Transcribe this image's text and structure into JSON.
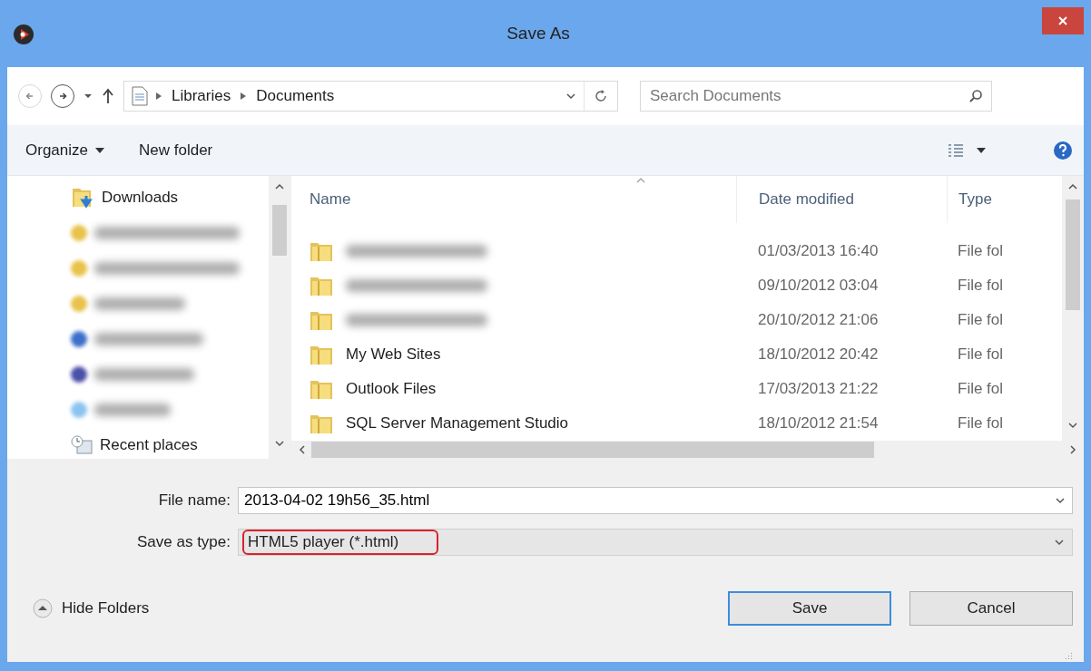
{
  "window": {
    "title": "Save As"
  },
  "nav": {
    "back": {
      "disabled": true
    },
    "forward": {
      "disabled": false
    }
  },
  "address": {
    "crumbs": [
      "Libraries",
      "Documents"
    ]
  },
  "search": {
    "placeholder": "Search Documents"
  },
  "toolbar": {
    "buttons": [
      {
        "label": "Organize",
        "dropdown": true
      },
      {
        "label": "New folder",
        "dropdown": false
      }
    ]
  },
  "sidebar": {
    "items": [
      {
        "kind": "downloads",
        "label": "Downloads"
      },
      {
        "kind": "blurred",
        "color": "#e8c24a"
      },
      {
        "kind": "blurred",
        "color": "#e8c24a"
      },
      {
        "kind": "blurred",
        "color": "#e8c24a"
      },
      {
        "kind": "blurred",
        "color": "#3b6fc9"
      },
      {
        "kind": "blurred",
        "color": "#4a4fa8"
      },
      {
        "kind": "blurred",
        "color": "#8cc4f0"
      },
      {
        "kind": "recent",
        "label": "Recent places"
      }
    ]
  },
  "files": {
    "columns": [
      "Name",
      "Date modified",
      "Type"
    ],
    "rows": [
      {
        "kind": "blurred",
        "date": "01/03/2013 16:40",
        "type": "File fol"
      },
      {
        "kind": "blurred",
        "date": "09/10/2012 03:04",
        "type": "File fol"
      },
      {
        "kind": "blurred",
        "date": "20/10/2012 21:06",
        "type": "File fol"
      },
      {
        "kind": "folder",
        "name": "My Web Sites",
        "date": "18/10/2012 20:42",
        "type": "File fol"
      },
      {
        "kind": "folder",
        "name": "Outlook Files",
        "date": "17/03/2013 21:22",
        "type": "File fol"
      },
      {
        "kind": "folder",
        "name": "SQL Server Management Studio",
        "date": "18/10/2012 21:54",
        "type": "File fol"
      }
    ]
  },
  "form": {
    "file_name": {
      "label": "File name:",
      "value": "2013-04-02 19h56_35.html"
    },
    "save_as_type": {
      "label": "Save as type:",
      "value": "HTML5 player (*.html)",
      "highlighted": true
    }
  },
  "footer": {
    "hide_folders": "Hide Folders",
    "buttons": [
      {
        "label": "Save",
        "default": true
      },
      {
        "label": "Cancel",
        "default": false
      }
    ]
  }
}
